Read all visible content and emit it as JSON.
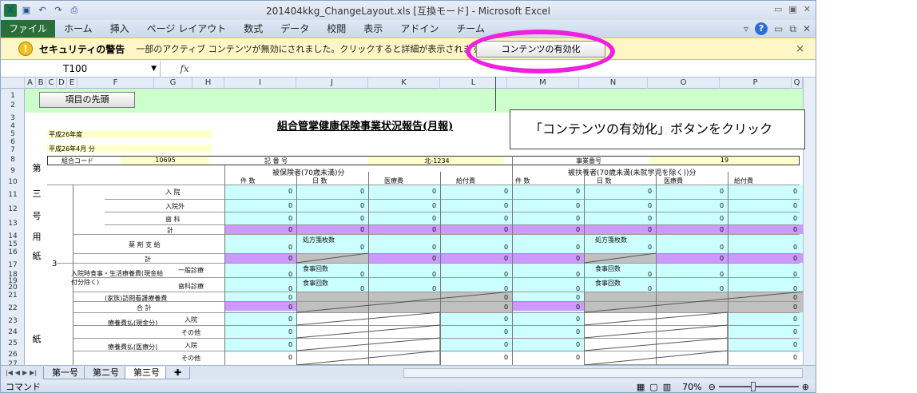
{
  "window": {
    "title": "201404kkg_ChangeLayout.xls [互換モード] - Microsoft Excel",
    "app_icon": "X"
  },
  "ribbon": {
    "file_tab": "ファイル",
    "tabs": [
      "ホーム",
      "挿入",
      "ページ レイアウト",
      "数式",
      "データ",
      "校閲",
      "表示",
      "アドイン",
      "チーム"
    ]
  },
  "security_bar": {
    "title": "セキュリティの警告",
    "message": "一部のアクティブ コンテンツが無効にされました。クリックすると詳細が表示されます。",
    "enable_button": "コンテンツの有効化",
    "close": "×"
  },
  "formula_bar": {
    "name_box": "T100",
    "fx": "fx",
    "value": ""
  },
  "columns": [
    "A",
    "B",
    "C",
    "D",
    "E",
    "F",
    "G",
    "H",
    "I",
    "J",
    "K",
    "L",
    "M",
    "N",
    "O",
    "P",
    "Q"
  ],
  "rows": [
    "1",
    "2",
    "3",
    "4",
    "5",
    "6",
    "7",
    "8",
    "9",
    "10",
    "11",
    "12",
    "13",
    "14",
    "15",
    "16",
    "17",
    "18",
    "19",
    "20",
    "21",
    "22",
    "23",
    "24",
    "25",
    "26",
    "27"
  ],
  "sheet": {
    "button_label": "項目の先頭",
    "report_title": "組合管掌健康保険事業状況報告(月報)",
    "year_label": "平成26年度",
    "month_label": "平成26年4月 分",
    "kumiai_code_label": "組合コード",
    "kumiai_code": "10695",
    "kigo_label": "記 番 号",
    "kigo_value": "北-1234",
    "jigyosho_label": "事業番号",
    "jigyosho_value": "19",
    "section1": "被保険者(70歳未満)分",
    "section2": "被扶養者(70歳未満(未就学児を除く))分",
    "sub_headers": [
      "件 数",
      "日 数",
      "医療費",
      "給付費"
    ],
    "side_labels": [
      "第",
      "三",
      "号",
      "用",
      "紙"
    ],
    "side_num": "3",
    "row_labels": [
      "入 院",
      "入院外",
      "歯 科",
      "計",
      "薬 剤 支 給",
      "計",
      "一般診療",
      "歯科診療",
      "(家族)訪問看護療養費",
      "合 計",
      "入院",
      "その他",
      "入院",
      "その他"
    ],
    "mid_label": "入院時食事・生活療養費(現金給付分除く)",
    "shohousen": "処方箋枚数",
    "shokuji": "食事回数",
    "zero": "0",
    "kyoutei1": "療養費払(現金分)",
    "kyoutei2": "療養費払(医療分)"
  },
  "sheet_tabs": [
    "第一号",
    "第二号",
    "第三号"
  ],
  "status": {
    "mode": "コマンド",
    "zoom": "70%"
  },
  "callout": {
    "text": "「コンテンツの有効化」ボタンをクリック"
  }
}
